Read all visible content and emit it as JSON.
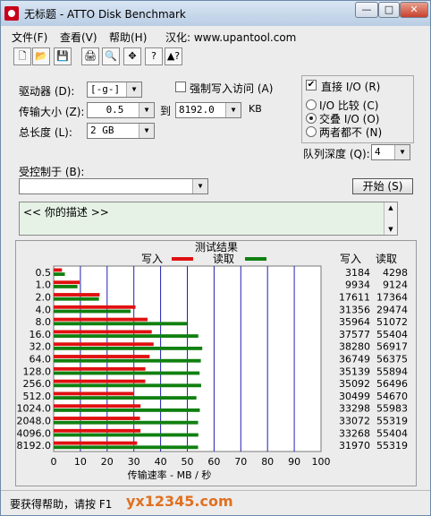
{
  "window": {
    "title": "无标题 - ATTO Disk Benchmark",
    "min_glyph": "—",
    "max_glyph": "□",
    "close_glyph": "✕"
  },
  "menu": [
    "文件(F)",
    "查看(V)",
    "帮助(H)",
    "汉化: www.upantool.com"
  ],
  "toolbar": [
    "new",
    "open",
    "save",
    "print",
    "print-preview",
    "move",
    "help",
    "context-help"
  ],
  "toolbar_icons": [
    "🗋",
    "📂",
    "💾",
    "🖨",
    "🔍",
    "✥",
    "?",
    "▲?"
  ],
  "form": {
    "drive_label": "驱动器 (D):",
    "drive_value": "[-g-]",
    "force_write_label": "强制写入访问 (A)",
    "force_write_checked": false,
    "transfer_label": "传输大小 (Z):",
    "transfer_from": "0.5",
    "to_label": "到",
    "transfer_to": "8192.0",
    "transfer_unit": "KB",
    "total_length_label": "总长度 (L):",
    "total_length_value": "2 GB",
    "direct_io_label": "直接 I/O (R)",
    "direct_io_checked": true,
    "radio_io_compare": "I/O 比较 (C)",
    "radio_overlap": "交叠 I/O (O)",
    "radio_neither": "两者都不 (N)",
    "queue_label": "队列深度 (Q):",
    "queue_value": "4",
    "controlled_by_label": "受控制于 (B):",
    "start_button": "开始 (S)",
    "description_text": "<<   你的描述   >>"
  },
  "results": {
    "title": "测试结果",
    "legend_write": "写入",
    "legend_read": "读取",
    "col_write": "写入",
    "col_read": "读取",
    "colors": {
      "write": "#e01010",
      "read": "#108010",
      "grid": "#2020b0"
    }
  },
  "chart_data": {
    "type": "bar",
    "orientation": "horizontal",
    "xlabel": "传输速率 - MB / 秒",
    "xlim": [
      0,
      100
    ],
    "xticks": [
      "0",
      "10",
      "20",
      "30",
      "40",
      "50",
      "60",
      "70",
      "80",
      "90",
      "100"
    ],
    "categories": [
      "0.5",
      "1.0",
      "2.0",
      "4.0",
      "8.0",
      "16.0",
      "32.0",
      "64.0",
      "128.0",
      "256.0",
      "512.0",
      "1024.0",
      "2048.0",
      "4096.0",
      "8192.0"
    ],
    "series": [
      {
        "name": "写入",
        "values": [
          3184,
          9934,
          17611,
          31356,
          35964,
          37577,
          38280,
          36749,
          35139,
          35092,
          30499,
          33298,
          33072,
          33268,
          31970
        ]
      },
      {
        "name": "读取",
        "values": [
          4298,
          9124,
          17364,
          29474,
          51072,
          55404,
          56917,
          56375,
          55894,
          56496,
          54670,
          55983,
          55319,
          55404,
          55319
        ]
      }
    ]
  },
  "status": {
    "text": "要获得帮助，请按 F1",
    "watermark": "yx12345.com"
  }
}
